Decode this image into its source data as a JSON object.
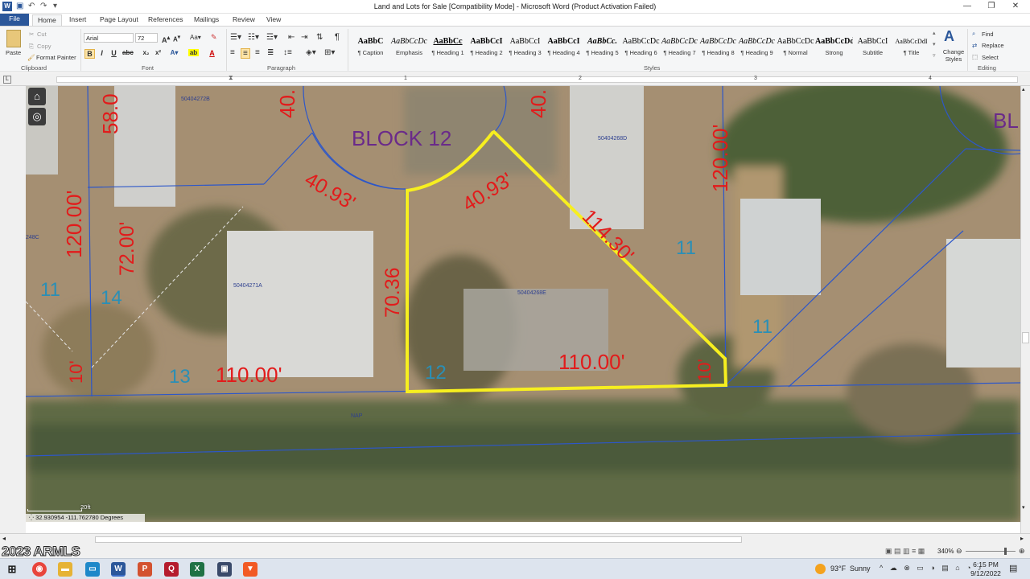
{
  "window": {
    "title": "Land and Lots for Sale [Compatibility Mode] - Microsoft Word (Product Activation Failed)",
    "app_icon": "word-icon"
  },
  "tabs": [
    "File",
    "Home",
    "Insert",
    "Page Layout",
    "References",
    "Mailings",
    "Review",
    "View"
  ],
  "active_tab": "Home",
  "ribbon": {
    "clipboard": {
      "label": "Clipboard",
      "paste": "Paste",
      "cut": "Cut",
      "copy": "Copy",
      "format_painter": "Format Painter"
    },
    "font": {
      "label": "Font",
      "name": "Arial",
      "size": "72"
    },
    "paragraph": {
      "label": "Paragraph"
    },
    "styles": {
      "label": "Styles",
      "items": [
        {
          "preview": "AaBbC",
          "name": "¶ Caption"
        },
        {
          "preview": "AaBbCcDc",
          "name": "Emphasis"
        },
        {
          "preview": "AaBbCc",
          "name": "¶ Heading 1"
        },
        {
          "preview": "AaBbCcI",
          "name": "¶ Heading 2"
        },
        {
          "preview": "AaBbCcI",
          "name": "¶ Heading 3"
        },
        {
          "preview": "AaBbCcI",
          "name": "¶ Heading 4"
        },
        {
          "preview": "AaBbCc.",
          "name": "¶ Heading 5"
        },
        {
          "preview": "AaBbCcDc",
          "name": "¶ Heading 6"
        },
        {
          "preview": "AaBbCcDc",
          "name": "¶ Heading 7"
        },
        {
          "preview": "AaBbCcDc",
          "name": "¶ Heading 8"
        },
        {
          "preview": "AaBbCcDc",
          "name": "¶ Heading 9"
        },
        {
          "preview": "AaBbCcDc",
          "name": "¶ Normal"
        },
        {
          "preview": "AaBbCcDd",
          "name": "Strong"
        },
        {
          "preview": "AaBbCcI",
          "name": "Subtitle"
        },
        {
          "preview": "AaBbCcDdI",
          "name": "¶ Title"
        }
      ],
      "change_styles": "Change Styles"
    },
    "editing": {
      "label": "Editing",
      "find": "Find",
      "replace": "Replace",
      "select": "Select"
    }
  },
  "ruler": {
    "numbers": [
      "1",
      "2",
      "3",
      "4"
    ]
  },
  "map": {
    "block_label": "BLOCK 12",
    "block_label_right": "BL",
    "parcel_ids": [
      "50404272B",
      "50404268D",
      "50404271A",
      "50404268E",
      "248C",
      "NAP"
    ],
    "dimensions": [
      "58.0",
      "40.",
      "40.93'",
      "40.93'",
      "40.",
      "114.30'",
      "120.00'",
      "120.00'",
      "72.00'",
      "70.36",
      "110.00'",
      "110.00'",
      "10'",
      "10'"
    ],
    "lot_numbers": [
      "11",
      "14",
      "13",
      "12",
      "11",
      "11"
    ],
    "scale_label": "20ft",
    "coordinates": "32.930954 -111.762780 Degrees",
    "colors": {
      "highlight": "#f7ef1f",
      "dimension": "#e21b1b",
      "lot_number": "#2a8fb6",
      "block": "#6a2a8a",
      "parcel_line": "#2d57c9"
    }
  },
  "status": {
    "zoom": "340%"
  },
  "watermark": "2023 ARMLS",
  "taskbar": {
    "weather_temp": "93°F",
    "weather_text": "Sunny",
    "time": "6:15 PM",
    "date": "9/12/2022"
  }
}
